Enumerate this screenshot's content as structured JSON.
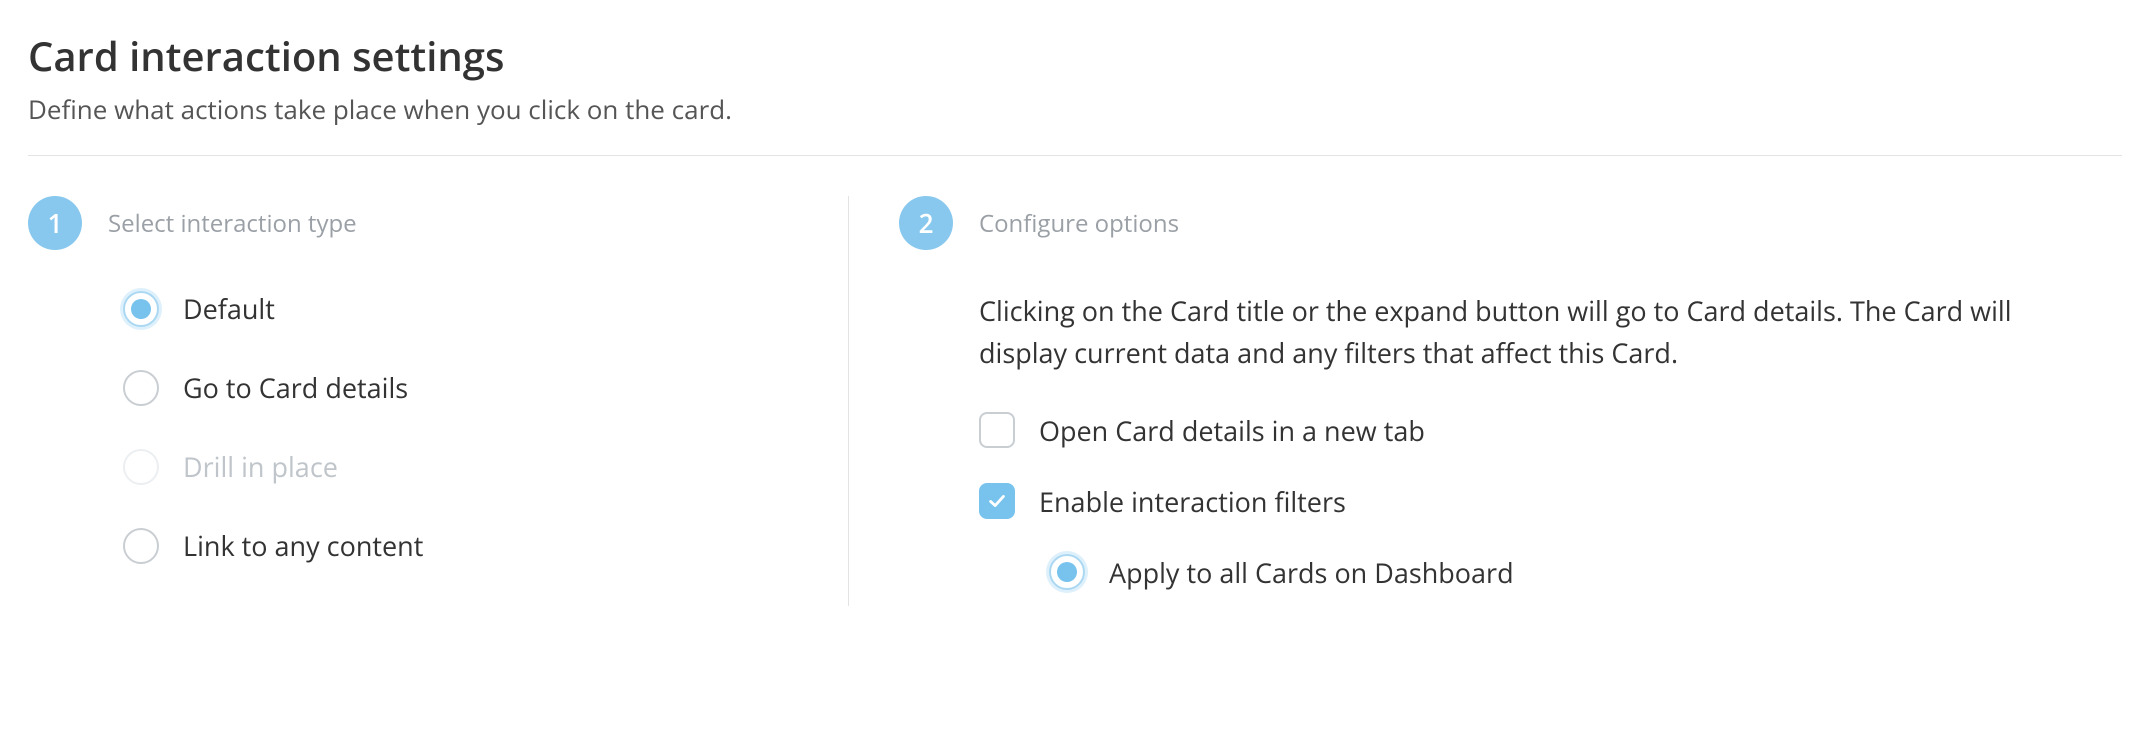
{
  "header": {
    "title": "Card interaction settings",
    "subtitle": "Define what actions take place when you click on the card."
  },
  "step1": {
    "badge": "1",
    "title": "Select interaction type",
    "options": {
      "default": "Default",
      "goto": "Go to Card details",
      "drill": "Drill in place",
      "link": "Link to any content"
    }
  },
  "step2": {
    "badge": "2",
    "title": "Configure options",
    "description": "Clicking on the Card title or the expand button will go to Card details. The Card will display current data and any filters that affect this Card.",
    "open_new_tab_label": "Open Card details in a new tab",
    "enable_filters_label": "Enable interaction filters",
    "apply_all_label": "Apply to all Cards on Dashboard"
  }
}
